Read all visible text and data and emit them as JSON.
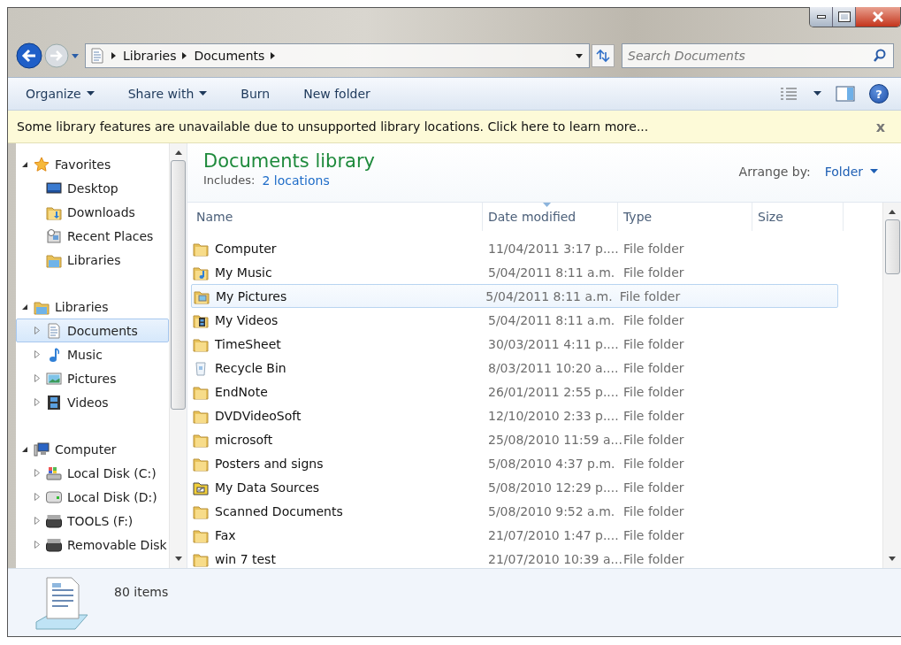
{
  "address_bar": {
    "crumbs": [
      "Libraries",
      "Documents"
    ]
  },
  "search": {
    "placeholder": "Search Documents"
  },
  "toolbar": {
    "buttons": [
      {
        "label": "Organize",
        "dropdown": true
      },
      {
        "label": "Share with",
        "dropdown": true
      },
      {
        "label": "Burn",
        "dropdown": false
      },
      {
        "label": "New folder",
        "dropdown": false
      }
    ],
    "help": "?"
  },
  "info_bar": {
    "message": "Some library features are unavailable due to unsupported library locations. Click here to learn more...",
    "close": "x"
  },
  "sidebar": {
    "groups": [
      {
        "label": "Favorites",
        "kind": "star",
        "expanded": true,
        "children": [
          {
            "label": "Desktop",
            "kind": "desktop",
            "selected": false
          },
          {
            "label": "Downloads",
            "kind": "downloads",
            "selected": false
          },
          {
            "label": "Recent Places",
            "kind": "recent",
            "selected": false
          },
          {
            "label": "Libraries",
            "kind": "library",
            "selected": false
          }
        ]
      },
      {
        "label": "Libraries",
        "kind": "library",
        "expanded": true,
        "children": [
          {
            "label": "Documents",
            "kind": "document",
            "expanded": false,
            "selected": true
          },
          {
            "label": "Music",
            "kind": "music",
            "expanded": false,
            "selected": false
          },
          {
            "label": "Pictures",
            "kind": "pictures",
            "expanded": false,
            "selected": false
          },
          {
            "label": "Videos",
            "kind": "videos",
            "expanded": false,
            "selected": false
          }
        ]
      },
      {
        "label": "Computer",
        "kind": "computer",
        "expanded": true,
        "children": [
          {
            "label": "Local Disk (C:)",
            "kind": "system-disk",
            "expanded": false,
            "selected": false
          },
          {
            "label": "Local Disk (D:)",
            "kind": "disk",
            "expanded": false,
            "selected": false
          },
          {
            "label": "TOOLS (F:)",
            "kind": "removable",
            "expanded": false,
            "selected": false
          },
          {
            "label": "Removable Disk",
            "kind": "removable",
            "expanded": false,
            "selected": false
          }
        ]
      }
    ]
  },
  "library": {
    "title": "Documents library",
    "includes_label": "Includes:",
    "includes_link": "2 locations",
    "arrange_label": "Arrange by:",
    "arrange_value": "Folder"
  },
  "table": {
    "columns": [
      {
        "label": "Name",
        "sorted": false
      },
      {
        "label": "Date modified",
        "sorted": true
      },
      {
        "label": "Type",
        "sorted": false
      },
      {
        "label": "Size",
        "sorted": false
      }
    ],
    "rows": [
      {
        "name": "Computer",
        "kind": "folder",
        "date": "11/04/2011 3:17 p....",
        "type": "File folder",
        "selected": false
      },
      {
        "name": "My Music",
        "kind": "music-folder",
        "date": "5/04/2011 8:11 a.m.",
        "type": "File folder",
        "selected": false
      },
      {
        "name": "My Pictures",
        "kind": "pictures-folder",
        "date": "5/04/2011 8:11 a.m.",
        "type": "File folder",
        "selected": true
      },
      {
        "name": "My Videos",
        "kind": "videos-folder",
        "date": "5/04/2011 8:11 a.m.",
        "type": "File folder",
        "selected": false
      },
      {
        "name": "TimeSheet",
        "kind": "folder",
        "date": "30/03/2011 4:11 p....",
        "type": "File folder",
        "selected": false
      },
      {
        "name": "Recycle Bin",
        "kind": "recycle-bin",
        "date": "8/03/2011 10:20 a....",
        "type": "File folder",
        "selected": false
      },
      {
        "name": "EndNote",
        "kind": "folder",
        "date": "26/01/2011 2:55 p....",
        "type": "File folder",
        "selected": false
      },
      {
        "name": "DVDVideoSoft",
        "kind": "folder",
        "date": "12/10/2010 2:33 p....",
        "type": "File folder",
        "selected": false
      },
      {
        "name": "microsoft",
        "kind": "folder",
        "date": "25/08/2010 11:59 a...",
        "type": "File folder",
        "selected": false
      },
      {
        "name": "Posters and signs",
        "kind": "folder",
        "date": "5/08/2010 4:37 p.m.",
        "type": "File folder",
        "selected": false
      },
      {
        "name": "My Data Sources",
        "kind": "data-folder",
        "date": "5/08/2010 12:29 p....",
        "type": "File folder",
        "selected": false
      },
      {
        "name": "Scanned Documents",
        "kind": "folder",
        "date": "5/08/2010 9:52 a.m.",
        "type": "File folder",
        "selected": false
      },
      {
        "name": "Fax",
        "kind": "folder",
        "date": "21/07/2010 1:47 p....",
        "type": "File folder",
        "selected": false
      },
      {
        "name": "win 7 test",
        "kind": "folder",
        "date": "21/07/2010 10:39 a...",
        "type": "File folder",
        "selected": false
      }
    ]
  },
  "status_bar": {
    "count": "80 items"
  }
}
